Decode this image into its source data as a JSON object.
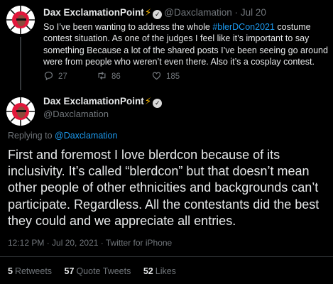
{
  "first_tweet": {
    "display_name": "Dax ExclamationPoint",
    "handle": "@Daxclamation",
    "separator": "·",
    "date": "Jul 20",
    "text_before_tag": "So I’ve been wanting to address the whole ",
    "hashtag": "#blerDCon2021",
    "text_after_tag": " costume contest situation. As one of the judges I feel like it’s important to say something Because a lot of the shared posts I’ve been seeing go around were from people who weren’t even there. Also it’s a cosplay contest.",
    "actions": {
      "replies": "27",
      "retweets": "86",
      "likes": "185"
    }
  },
  "main_tweet": {
    "display_name": "Dax ExclamationPoint",
    "handle": "@Daxclamation",
    "replying_prefix": "Replying to ",
    "replying_handle": "@Daxclamation",
    "text": "First and foremost I love blerdcon because of its inclusivity. It’s called “blerdcon” but that doesn’t mean other people of other ethnicities and backgrounds can’t participate. Regardless. All the contestants did the best they could and we appreciate all entries.",
    "timestamp": "12:12 PM · Jul 20, 2021 · Twitter for iPhone",
    "stats": {
      "retweets_count": "5",
      "retweets_label": "Retweets",
      "quotes_count": "57",
      "quotes_label": "Quote Tweets",
      "likes_count": "52",
      "likes_label": "Likes"
    }
  },
  "colors": {
    "background": "#000000",
    "link": "#1d9bf0",
    "muted": "#71767b",
    "text": "#e7e9ea",
    "bolt": "#f5b400"
  },
  "icons": [
    "avatar-image",
    "lightning-bolt-icon",
    "verified-badge-icon",
    "reply-icon",
    "retweet-icon",
    "like-icon"
  ]
}
